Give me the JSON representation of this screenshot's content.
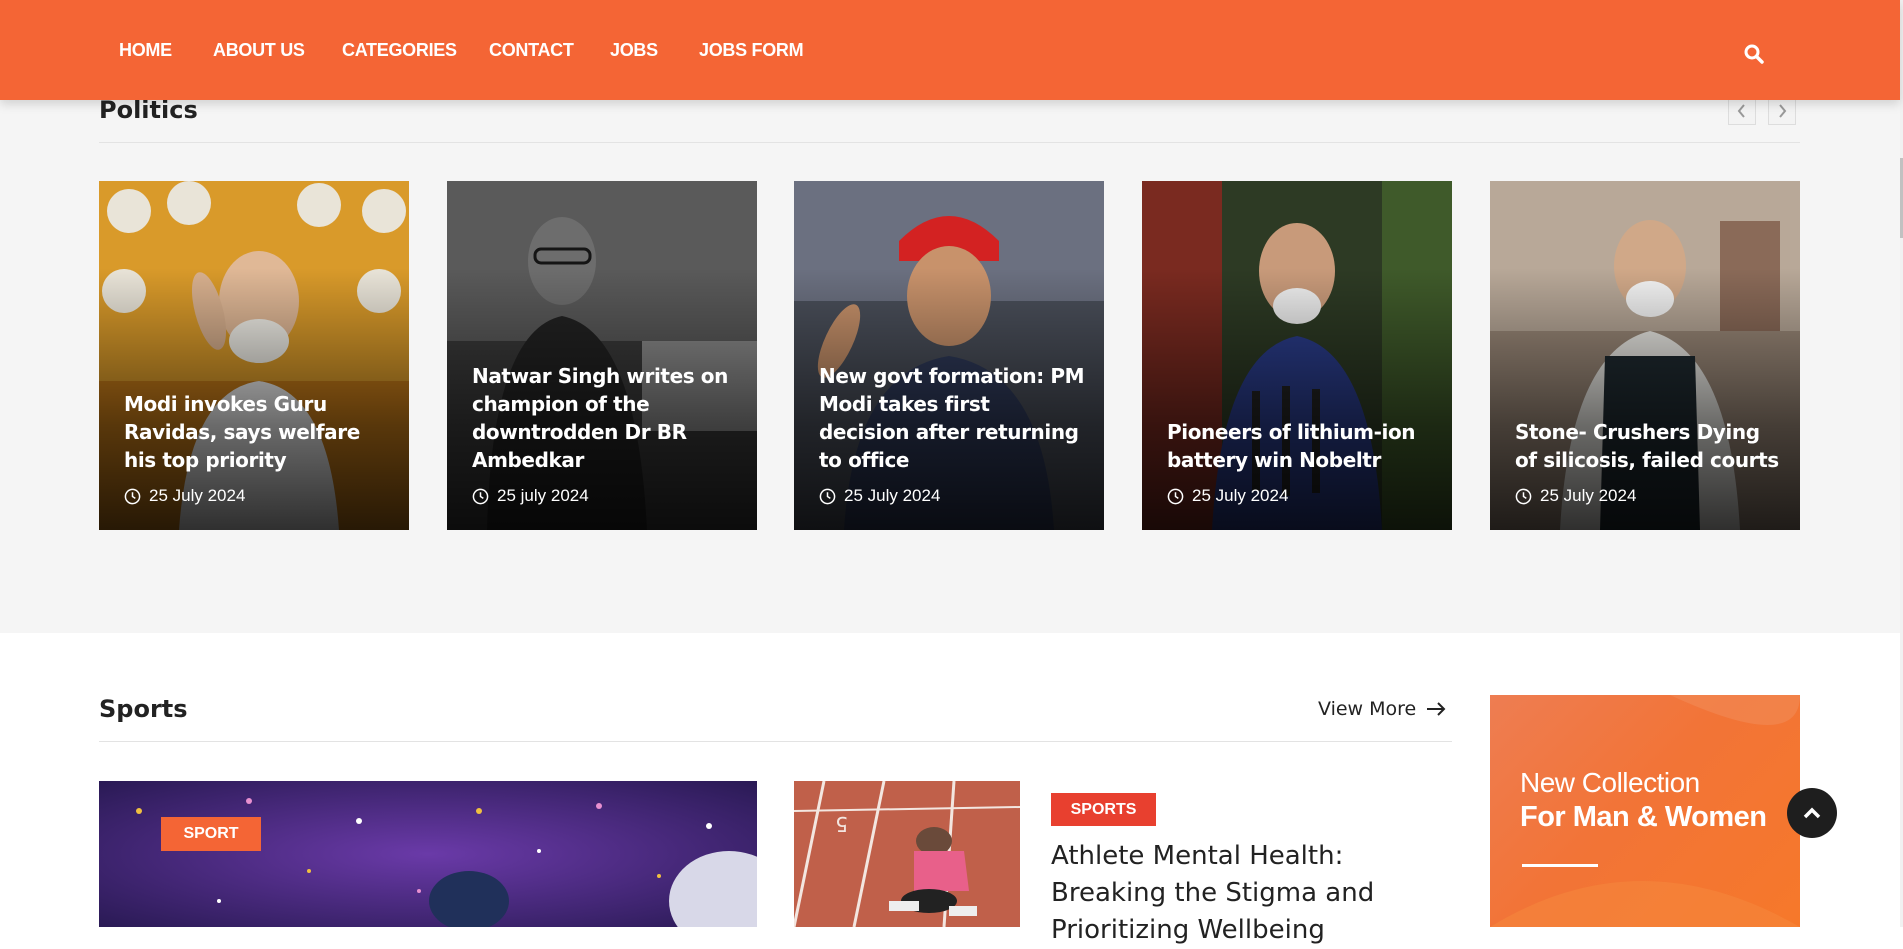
{
  "nav": {
    "items": [
      "HOME",
      "ABOUT US",
      "CATEGORIES",
      "CONTACT",
      "JOBS",
      "JOBS FORM"
    ],
    "search_icon": "search-icon"
  },
  "politics": {
    "title": "Politics",
    "prev_icon": "chevron-left-icon",
    "next_icon": "chevron-right-icon",
    "cards": [
      {
        "title": "Modi invokes Guru Ravidas, says welfare his top priority",
        "date": "25 July 2024"
      },
      {
        "title": "Natwar Singh writes on champion of the downtrodden Dr BR Ambedkar",
        "date": "25 july 2024"
      },
      {
        "title": "New govt formation: PM Modi takes first decision after returning to office",
        "date": "25 July 2024"
      },
      {
        "title": "Pioneers of lithium-ion battery win Nobeltr",
        "date": "25 July 2024"
      },
      {
        "title": "Stone- Crushers Dying of silicosis, failed courts",
        "date": "25 July 2024"
      }
    ]
  },
  "sports": {
    "title": "Sports",
    "view_more": "View More",
    "featured_badge": "SPORT",
    "article_badge": "SPORTS",
    "article_title": "Athlete Mental Health: Breaking the Stigma and Prioritizing Wellbeing"
  },
  "ad": {
    "line1": "New Collection",
    "line2": "For Man & Women"
  },
  "colors": {
    "brand": "#f46535",
    "badge_red": "#e8402f",
    "background_gray": "#f5f5f5"
  }
}
